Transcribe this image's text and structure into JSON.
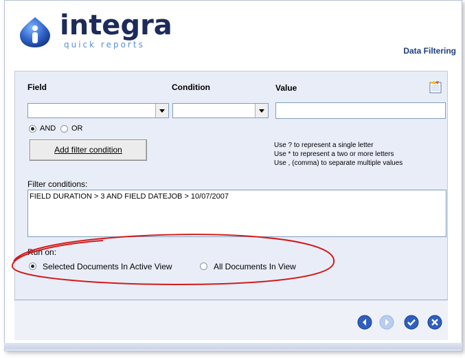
{
  "header": {
    "logo_name": "integra",
    "logo_tagline": "quick reports",
    "title": "Data Filtering"
  },
  "form": {
    "field_label": "Field",
    "condition_label": "Condition",
    "value_label": "Value",
    "field_value": "",
    "condition_value": "",
    "value_value": "",
    "logic": {
      "and_label": "AND",
      "or_label": "OR",
      "selected": "AND"
    },
    "add_button_label": "Add filter condition",
    "hints": [
      "Use ? to represent a single letter",
      "Use * to represent a two or more letters",
      "Use , (comma) to separate multiple values"
    ],
    "filter_conditions_label": "Filter conditions:",
    "filter_conditions_text": "FIELD DURATION > 3 AND FIELD DATEJOB > 10/07/2007"
  },
  "run_on": {
    "label": "Run on:",
    "option_selected": "Selected Documents In Active View",
    "option_all": "All Documents In View",
    "selected": "Selected Documents In Active View"
  },
  "nav": {
    "back_icon": "arrow-left-icon",
    "next_icon": "arrow-right-icon",
    "ok_icon": "checkmark-icon",
    "cancel_icon": "close-icon"
  },
  "colors": {
    "brand_navy": "#1d2b5a",
    "brand_blue": "#3b6fc6",
    "panel_bg": "#e9edf7",
    "highlight_red": "#d11a1a"
  }
}
